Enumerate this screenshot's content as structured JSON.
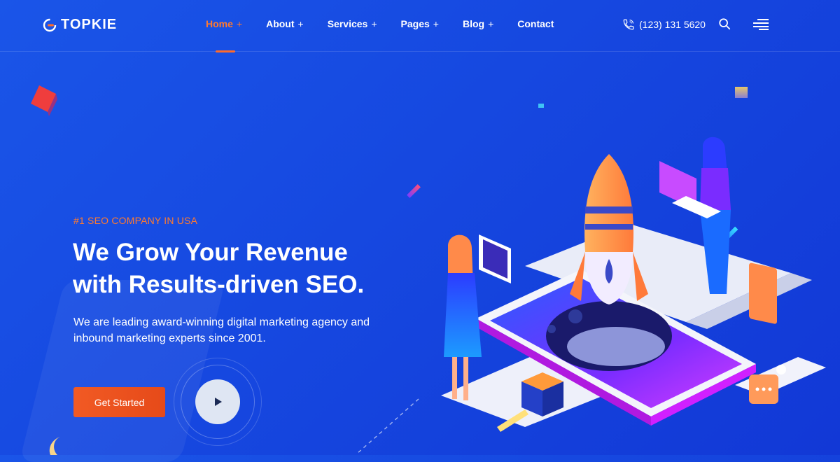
{
  "brand": {
    "name": "TOPKIE"
  },
  "nav": {
    "items": [
      {
        "label": "Home",
        "suffix": "+"
      },
      {
        "label": "About",
        "suffix": "+"
      },
      {
        "label": "Services",
        "suffix": "+"
      },
      {
        "label": "Pages",
        "suffix": "+"
      },
      {
        "label": "Blog",
        "suffix": "+"
      },
      {
        "label": "Contact",
        "suffix": ""
      }
    ],
    "active_index": 0
  },
  "contact": {
    "phone": "(123) 131 5620"
  },
  "icons": {
    "phone": "phone-icon",
    "search": "search-icon",
    "menu": "hamburger-menu-icon",
    "play": "play-icon"
  },
  "hero": {
    "tagline": "#1 SEO COMPANY IN USA",
    "headline_line1": "We Grow Your Revenue",
    "headline_line2": "with Results-driven SEO.",
    "description_line1": "We are leading award-winning digital marketing agency and",
    "description_line2": "inbound marketing experts since 2001.",
    "cta_label": "Get Started"
  },
  "colors": {
    "background": "#1648e0",
    "accent": "#f15a24",
    "accent_text": "#ff7a2e",
    "text": "#ffffff"
  }
}
